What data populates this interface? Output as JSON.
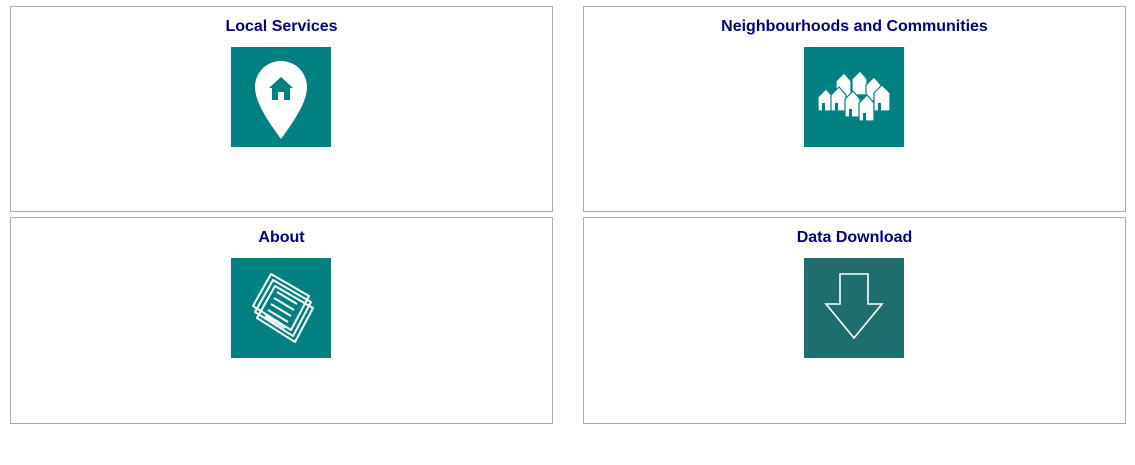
{
  "cards": [
    {
      "title": "Local Services",
      "icon": "map-pin-home-icon",
      "tile_color": "#008080"
    },
    {
      "title": "Neighbourhoods and Communities",
      "icon": "houses-community-icon",
      "tile_color": "#008080"
    },
    {
      "title": "About",
      "icon": "document-pages-icon",
      "tile_color": "#008080"
    },
    {
      "title": "Data Download",
      "icon": "download-arrow-icon",
      "tile_color": "#1f6e6e"
    }
  ],
  "colors": {
    "title_text": "#000080",
    "card_border": "#a9a9a9",
    "background": "#ffffff"
  }
}
